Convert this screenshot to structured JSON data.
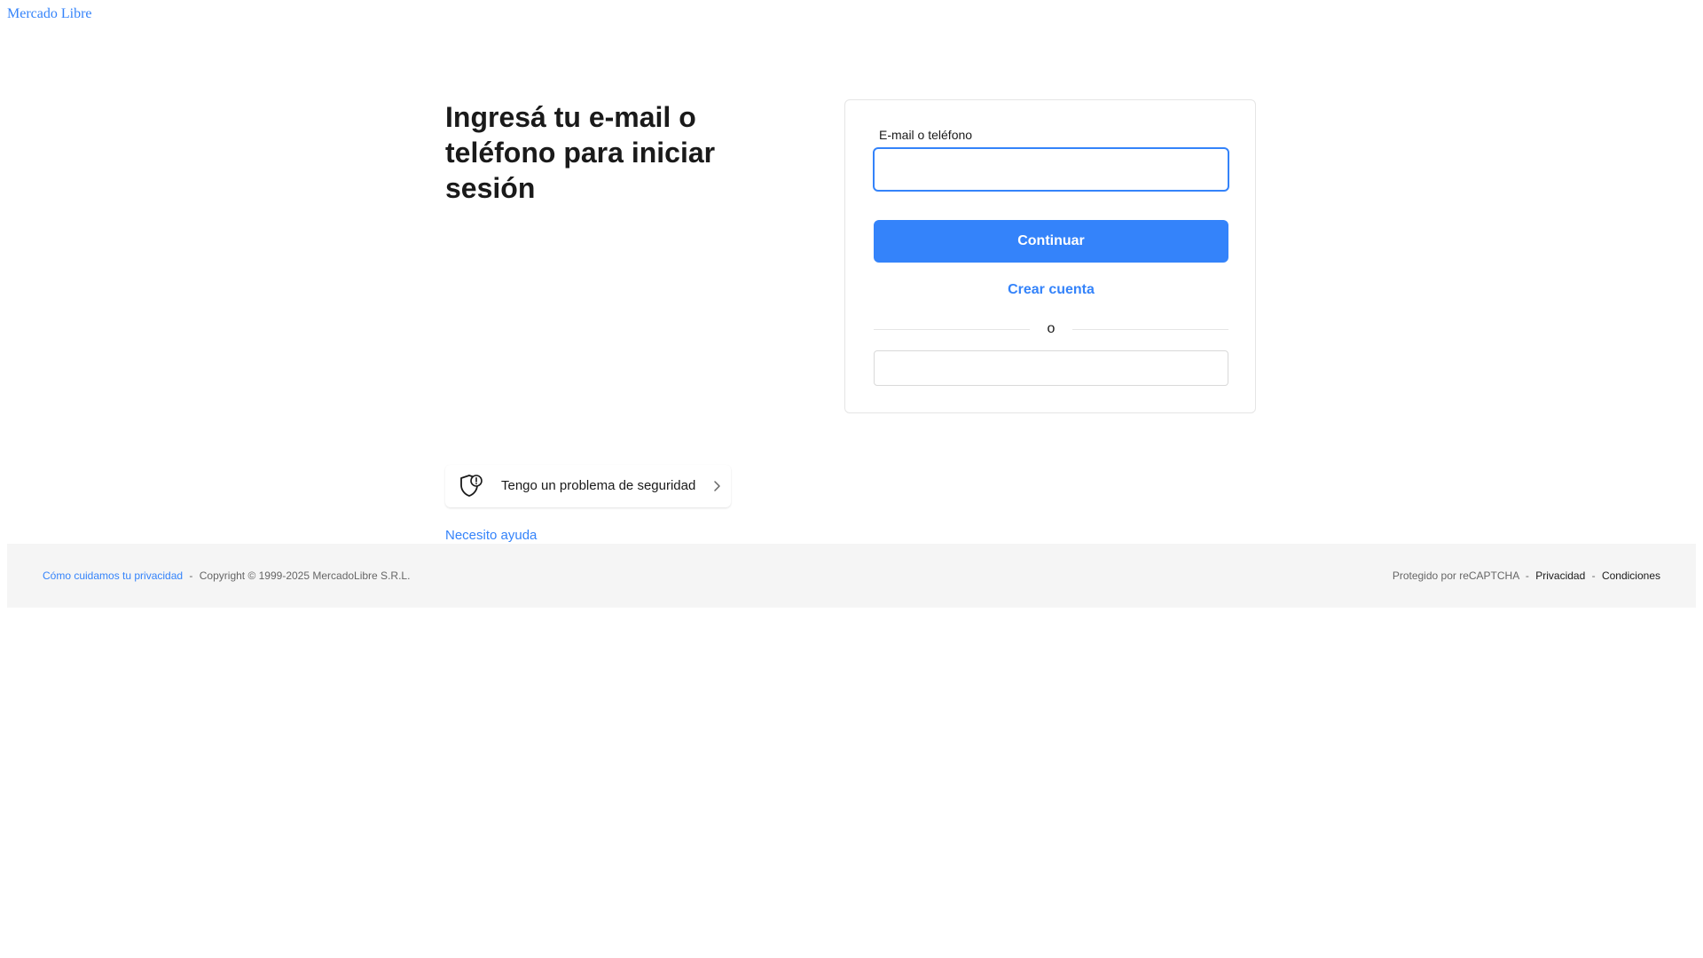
{
  "header": {
    "brand": "Mercado Libre"
  },
  "main": {
    "title": "Ingresá tu e-mail o teléfono para iniciar sesión"
  },
  "login_card": {
    "email_label": "E-mail o teléfono",
    "email_value": "",
    "continue_label": "Continuar",
    "create_account_label": "Crear cuenta",
    "divider_text": "o"
  },
  "security": {
    "label": "Tengo un problema de seguridad",
    "icon": "shield-alert-icon"
  },
  "help": {
    "label": "Necesito ayuda"
  },
  "footer": {
    "privacy_link": "Cómo cuidamos tu privacidad",
    "separator": "-",
    "copyright": "Copyright © 1999-2025 MercadoLibre S.R.L.",
    "recaptcha_text": "Protegido por reCAPTCHA",
    "privacy_label": "Privacidad",
    "terms_label": "Condiciones"
  },
  "colors": {
    "accent": "#3483fa",
    "text": "#1a1a1a",
    "footer_bg": "#f5f5f5",
    "border": "#e5e5e5"
  }
}
